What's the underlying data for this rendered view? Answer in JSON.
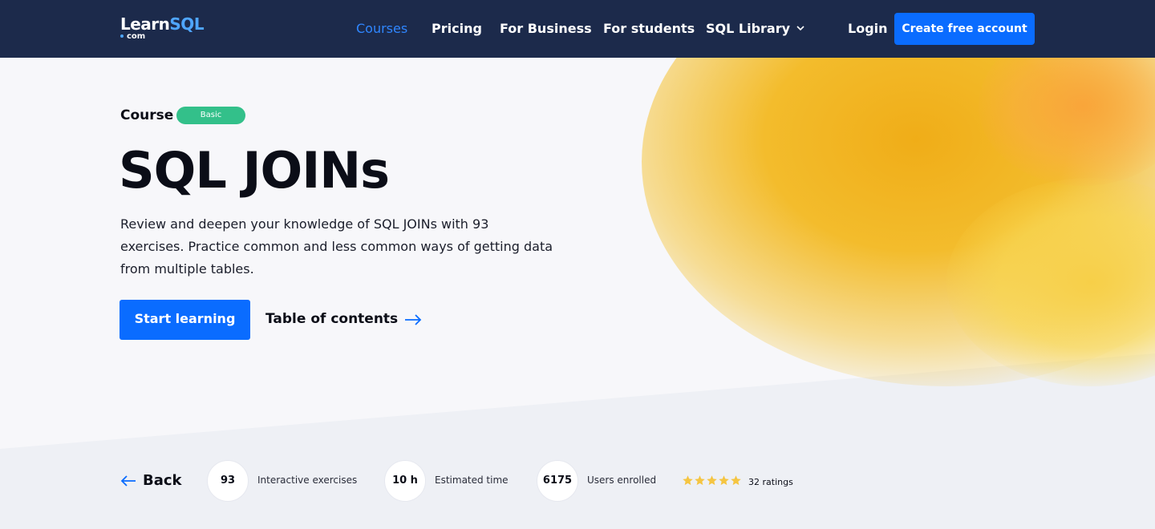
{
  "nav": {
    "logo_main": "Learn",
    "logo_sql": "SQL",
    "logo_com": "com",
    "links": [
      "Courses",
      "Pricing",
      "For Business",
      "For students",
      "SQL Library"
    ],
    "login": "Login",
    "create_account": "Create free account",
    "active_color": "#2f86ff",
    "background_color": "#1c2a4b"
  },
  "hero": {
    "course_label": "Course",
    "level_badge": "Basic",
    "title": "SQL JOINs",
    "description": "Review and deepen your knowledge of SQL JOINs with 93 exercises. Practice common and less common ways of getting data from  multiple tables.",
    "start_button": "Start learning",
    "toc_link": "Table of contents",
    "accent_color": "#0a6cff",
    "badge_color": "#33c08a"
  },
  "stats": {
    "back_label": "Back",
    "items": [
      {
        "value": "93",
        "label": "Interactive exercises"
      },
      {
        "value": "10 h",
        "label": "Estimated time"
      },
      {
        "value": "6175",
        "label": "Users enrolled"
      }
    ],
    "rating_stars": 5,
    "ratings_text": "32 ratings",
    "star_color": "#f5c542"
  }
}
